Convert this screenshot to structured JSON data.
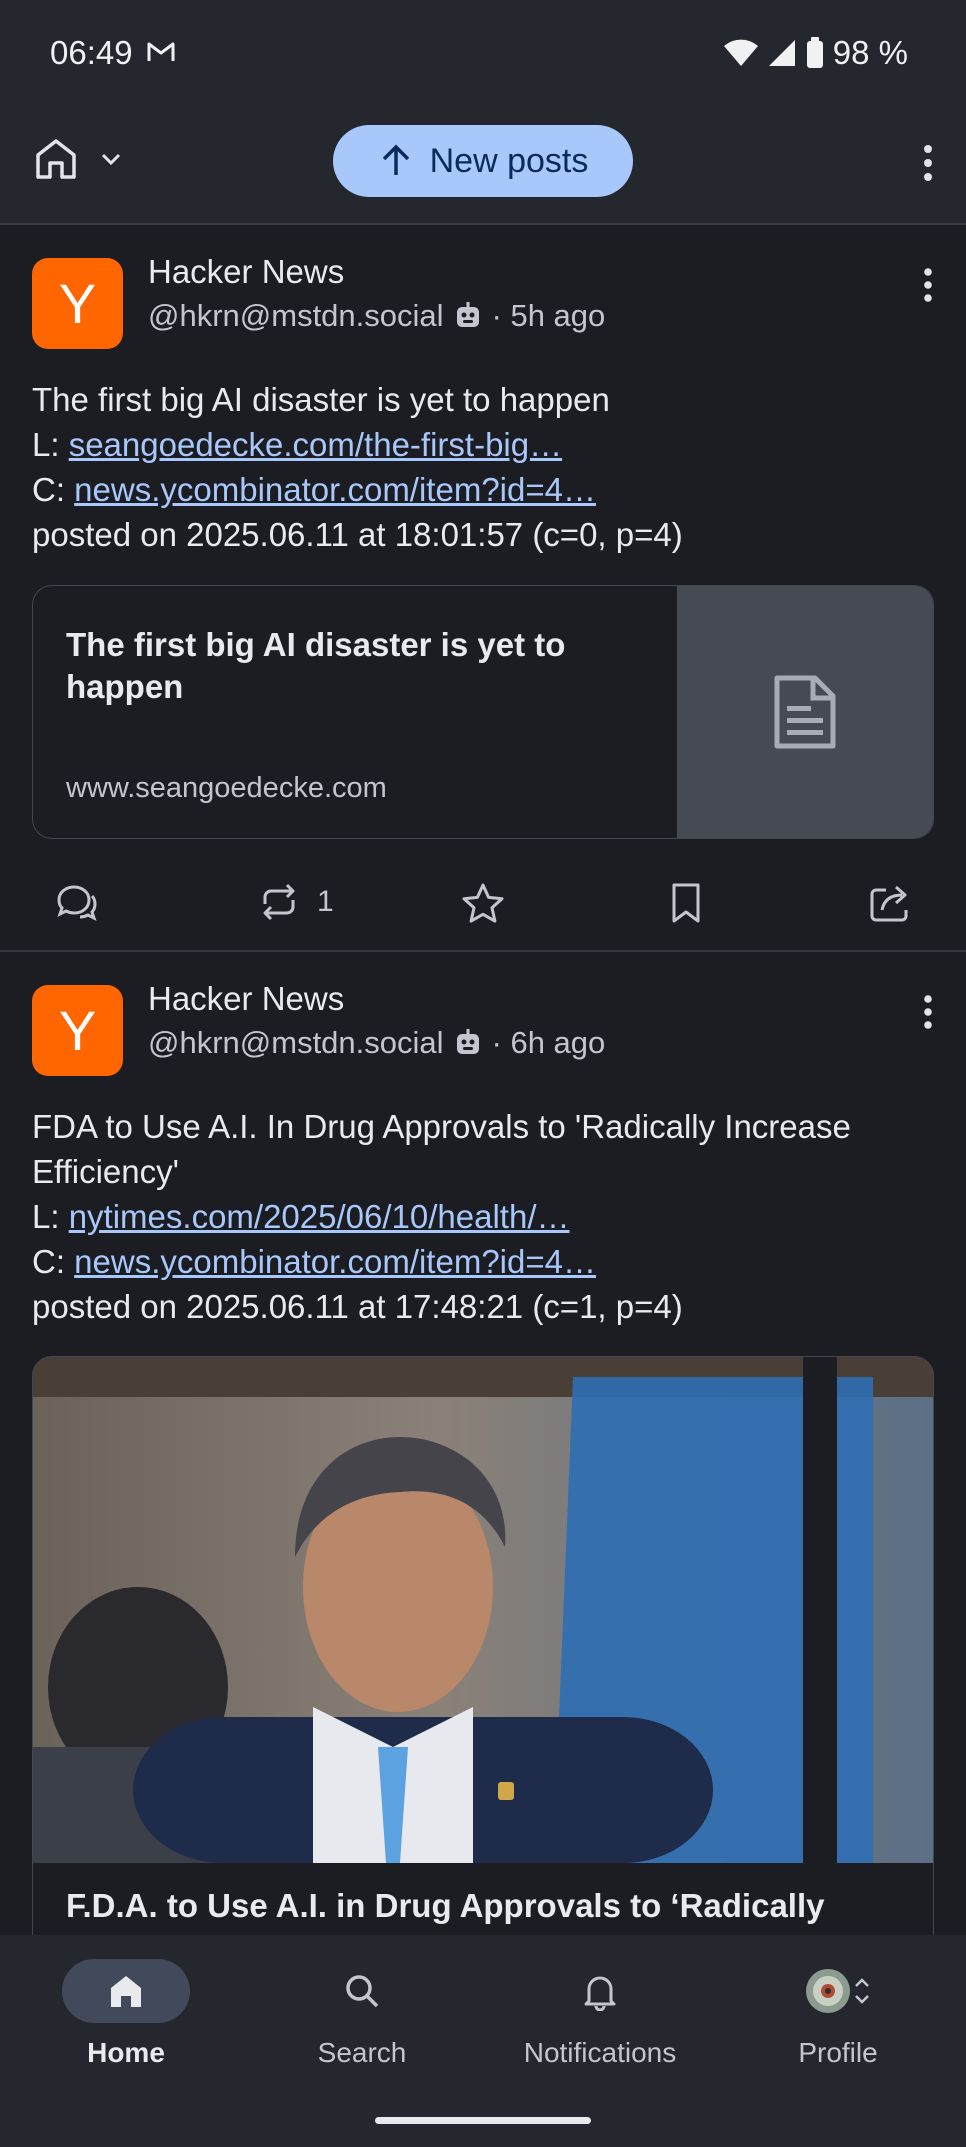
{
  "status_bar": {
    "time": "06:49",
    "battery": "98 %"
  },
  "top_bar": {
    "new_posts_label": "New posts"
  },
  "posts": [
    {
      "avatar_letter": "Y",
      "name": "Hacker News",
      "handle": "@hkrn@mstdn.social",
      "time": "· 5h ago",
      "title_line": "The first big AI disaster is yet to happen",
      "link_prefix": "L: ",
      "link": "seangoedecke.com/the-first-big…",
      "comments_prefix": "C: ",
      "comments_link": "news.ycombinator.com/item?id=4…",
      "posted": "posted on 2025.06.11 at 18:01:57 (c=0, p=4)",
      "card": {
        "title": "The first big AI disaster is yet to happen",
        "domain": "www.seangoedecke.com"
      },
      "boost_count": "1"
    },
    {
      "avatar_letter": "Y",
      "name": "Hacker News",
      "handle": "@hkrn@mstdn.social",
      "time": "· 6h ago",
      "title_line": "FDA to Use A.I. In Drug Approvals to 'Radically Increase Efficiency'",
      "link_prefix": "L: ",
      "link": "nytimes.com/2025/06/10/health/…",
      "comments_prefix": "C: ",
      "comments_link": "news.ycombinator.com/item?id=4…",
      "posted": "posted on 2025.06.11 at 17:48:21 (c=1, p=4)",
      "card": {
        "title": "F.D.A. to Use A.I. in Drug Approvals to ‘Radically"
      }
    }
  ],
  "bottom_nav": [
    {
      "label": "Home",
      "icon": "home-icon",
      "active": true
    },
    {
      "label": "Search",
      "icon": "search-icon"
    },
    {
      "label": "Notifications",
      "icon": "bell-icon"
    },
    {
      "label": "Profile",
      "icon": "profile-avatar"
    }
  ],
  "colors": {
    "accent": "#a8c7fa",
    "avatar": "#ff6600",
    "background": "#1b1d22"
  }
}
